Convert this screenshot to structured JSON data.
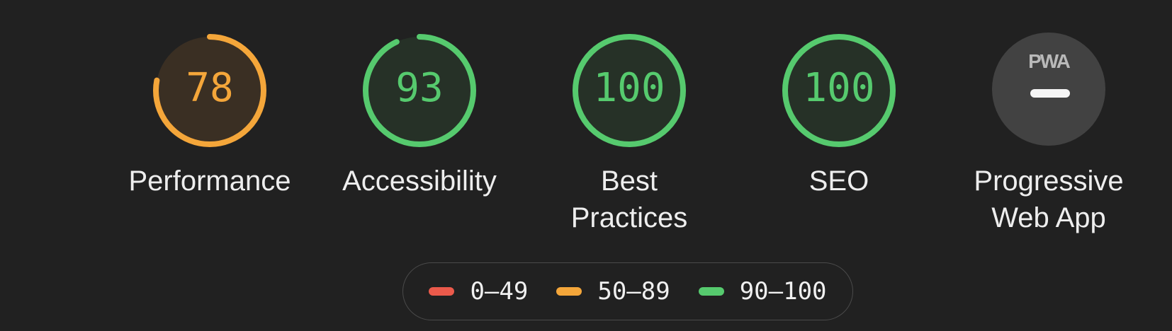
{
  "colors": {
    "fail": "#eb5a4b",
    "average": "#f4a63a",
    "pass": "#56ca6e",
    "average_bg": "#3a2f23",
    "pass_bg": "#263127",
    "track": "#424242"
  },
  "gauges": [
    {
      "score": "78",
      "label": "Performance",
      "fraction": 0.78,
      "rating": "average"
    },
    {
      "score": "93",
      "label": "Accessibility",
      "fraction": 0.93,
      "rating": "pass"
    },
    {
      "score": "100",
      "label": "Best Practices",
      "fraction": 1.0,
      "rating": "pass"
    },
    {
      "score": "100",
      "label": "SEO",
      "fraction": 1.0,
      "rating": "pass"
    }
  ],
  "pwa": {
    "logo_text": "PWA",
    "label": "Progressive Web App"
  },
  "legend": [
    {
      "range": "0–49",
      "rating": "fail"
    },
    {
      "range": "50–89",
      "rating": "average"
    },
    {
      "range": "90–100",
      "rating": "pass"
    }
  ]
}
